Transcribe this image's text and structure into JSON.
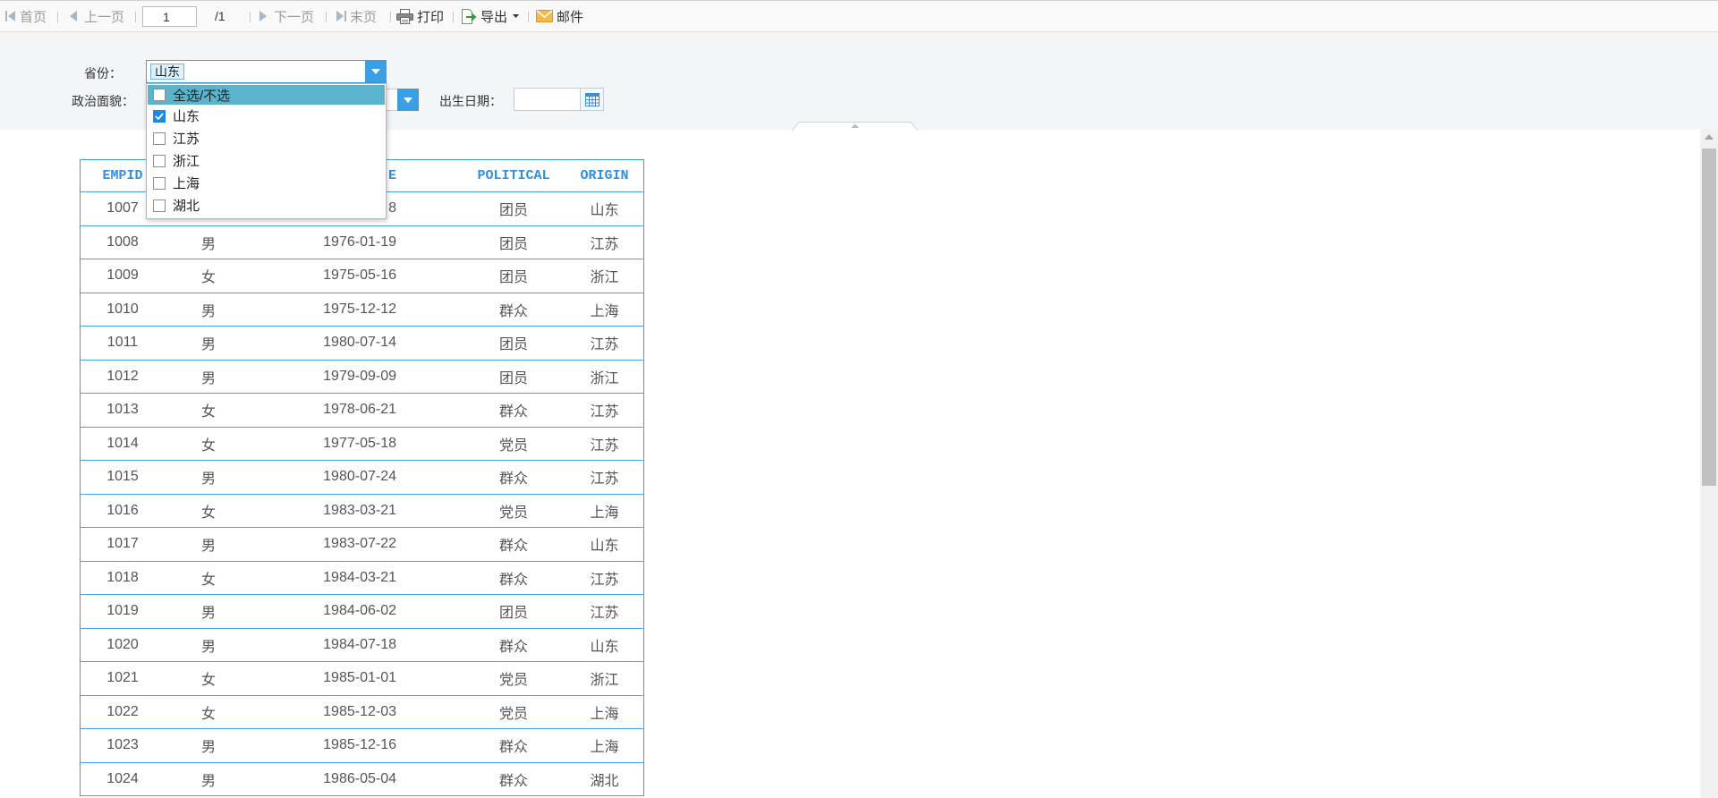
{
  "toolbar": {
    "first_label": "首页",
    "prev_label": "上一页",
    "page_input_value": "1",
    "page_total": "/1",
    "next_label": "下一页",
    "last_label": "末页",
    "print_label": "打印",
    "export_label": "导出",
    "mail_label": "邮件"
  },
  "params": {
    "province": {
      "label": "省份：",
      "selected_tag": "山东",
      "dropdown_open": true,
      "options": [
        {
          "label": "全选/不选",
          "checked": false,
          "highlighted": true
        },
        {
          "label": "山东",
          "checked": true,
          "highlighted": false
        },
        {
          "label": "江苏",
          "checked": false,
          "highlighted": false
        },
        {
          "label": "浙江",
          "checked": false,
          "highlighted": false
        },
        {
          "label": "上海",
          "checked": false,
          "highlighted": false
        },
        {
          "label": "湖北",
          "checked": false,
          "highlighted": false
        }
      ]
    },
    "political": {
      "label": "政治面貌："
    },
    "birth_date": {
      "label": "出生日期："
    }
  },
  "table": {
    "headers": {
      "empid": "EMPID",
      "date": "E",
      "political": "POLITICAL",
      "origin": "ORIGIN"
    },
    "rows": [
      {
        "empid": "1007",
        "date": "8",
        "political": "团员",
        "origin": "山东"
      },
      {
        "empid": "1008",
        "sex": "男",
        "date": "1976-01-19",
        "political": "团员",
        "origin": "江苏"
      },
      {
        "empid": "1009",
        "sex": "女",
        "date": "1975-05-16",
        "political": "团员",
        "origin": "浙江"
      },
      {
        "empid": "1010",
        "sex": "男",
        "date": "1975-12-12",
        "political": "群众",
        "origin": "上海"
      },
      {
        "empid": "1011",
        "sex": "男",
        "date": "1980-07-14",
        "political": "团员",
        "origin": "江苏"
      },
      {
        "empid": "1012",
        "sex": "男",
        "date": "1979-09-09",
        "political": "团员",
        "origin": "浙江"
      },
      {
        "empid": "1013",
        "sex": "女",
        "date": "1978-06-21",
        "political": "群众",
        "origin": "江苏"
      },
      {
        "empid": "1014",
        "sex": "女",
        "date": "1977-05-18",
        "political": "党员",
        "origin": "江苏"
      },
      {
        "empid": "1015",
        "sex": "男",
        "date": "1980-07-24",
        "political": "群众",
        "origin": "江苏"
      },
      {
        "empid": "1016",
        "sex": "女",
        "date": "1983-03-21",
        "political": "党员",
        "origin": "上海"
      },
      {
        "empid": "1017",
        "sex": "男",
        "date": "1983-07-22",
        "political": "群众",
        "origin": "山东"
      },
      {
        "empid": "1018",
        "sex": "女",
        "date": "1984-03-21",
        "political": "群众",
        "origin": "江苏"
      },
      {
        "empid": "1019",
        "sex": "男",
        "date": "1984-06-02",
        "political": "团员",
        "origin": "江苏"
      },
      {
        "empid": "1020",
        "sex": "男",
        "date": "1984-07-18",
        "political": "群众",
        "origin": "山东"
      },
      {
        "empid": "1021",
        "sex": "女",
        "date": "1985-01-01",
        "political": "党员",
        "origin": "浙江"
      },
      {
        "empid": "1022",
        "sex": "女",
        "date": "1985-12-03",
        "political": "党员",
        "origin": "上海"
      },
      {
        "empid": "1023",
        "sex": "男",
        "date": "1985-12-16",
        "political": "群众",
        "origin": "上海"
      },
      {
        "empid": "1024",
        "sex": "男",
        "date": "1986-05-04",
        "political": "群众",
        "origin": "湖北"
      }
    ]
  },
  "icons": {
    "first": "first-page-icon",
    "prev": "prev-page-icon",
    "next": "next-page-icon",
    "last": "last-page-icon",
    "print": "printer-icon",
    "export": "export-icon",
    "mail": "mail-icon",
    "date_picker": "calendar-icon"
  },
  "colors": {
    "accent": "#3d9fe3",
    "table_border": "#4ba3e3",
    "header_text": "#2f8fe0",
    "option_highlight": "#59b4cc",
    "checkbox_checked": "#1e88e5"
  }
}
